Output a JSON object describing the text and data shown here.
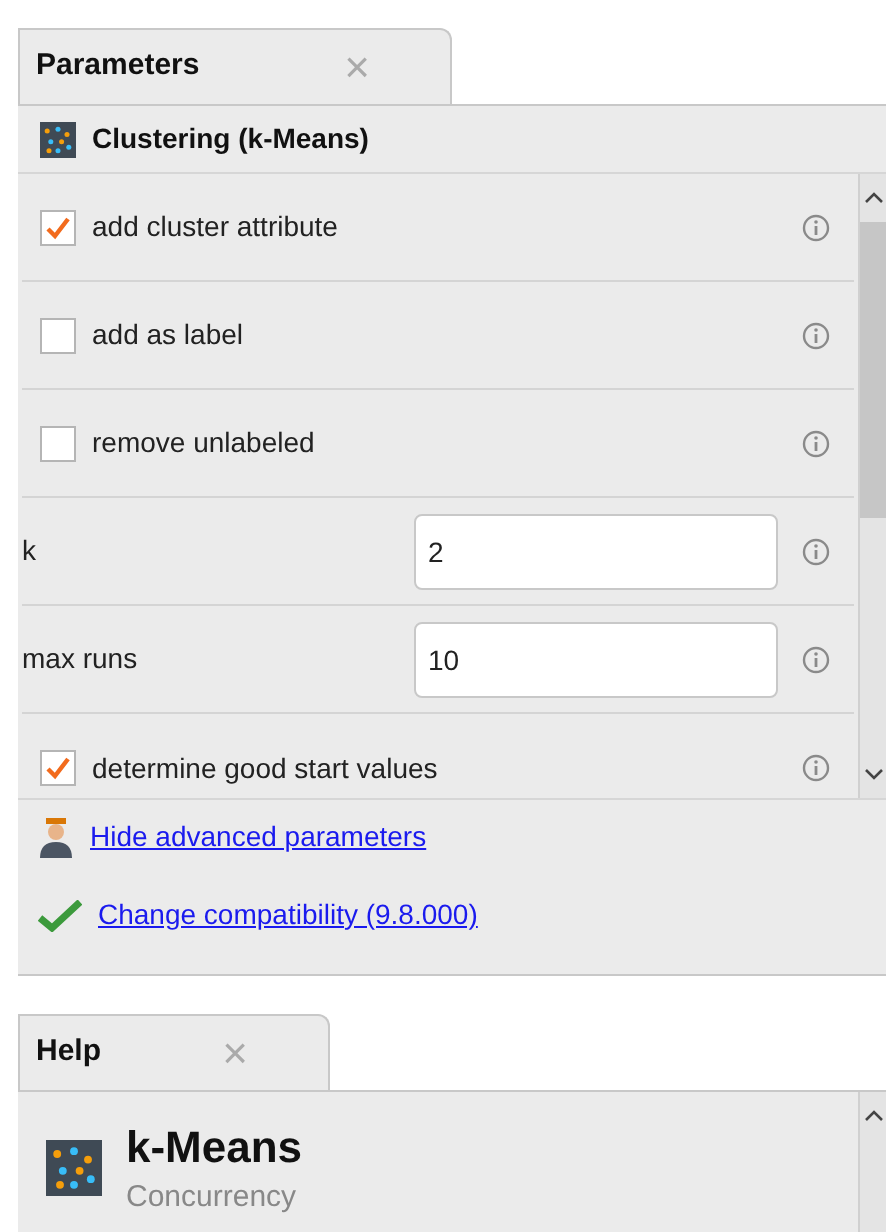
{
  "parameters_panel": {
    "tab": {
      "label": "Parameters",
      "close": "×",
      "selected": true
    },
    "operator": {
      "name": "Clustering (k-Means)"
    },
    "parameters": [
      {
        "kind": "checkbox",
        "label": "add cluster attribute",
        "checked": true
      },
      {
        "kind": "checkbox",
        "label": "add as label",
        "checked": false
      },
      {
        "kind": "checkbox",
        "label": "remove unlabeled",
        "checked": false
      },
      {
        "kind": "text",
        "label": "k",
        "value": "2"
      },
      {
        "kind": "text",
        "label": "max runs",
        "value": "10"
      },
      {
        "kind": "checkbox",
        "label": "determine good start values",
        "checked": true
      }
    ],
    "links": [
      {
        "kind": "advanced",
        "label": "Hide advanced parameters"
      },
      {
        "kind": "compat",
        "label": "Change compatibility (9.8.000)"
      }
    ]
  },
  "help_panel": {
    "tab": {
      "label": "Help",
      "close": "×",
      "selected": true
    },
    "title": "k-Means",
    "subtitle": "Concurrency"
  }
}
